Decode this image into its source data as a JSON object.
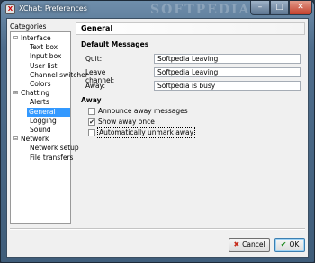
{
  "window": {
    "title": "XChat: Preferences",
    "watermark": "SOFTPEDIA",
    "minimize_glyph": "–",
    "maximize_glyph": "□",
    "close_glyph": "✕"
  },
  "sidebar": {
    "label": "Categories",
    "items": [
      {
        "label": "Interface",
        "level": 0,
        "expander": "⊟"
      },
      {
        "label": "Text box",
        "level": 1
      },
      {
        "label": "Input box",
        "level": 1
      },
      {
        "label": "User list",
        "level": 1
      },
      {
        "label": "Channel switcher",
        "level": 1
      },
      {
        "label": "Colors",
        "level": 1
      },
      {
        "label": "Chatting",
        "level": 0,
        "expander": "⊟"
      },
      {
        "label": "Alerts",
        "level": 1
      },
      {
        "label": "General",
        "level": 1,
        "selected": true
      },
      {
        "label": "Logging",
        "level": 1
      },
      {
        "label": "Sound",
        "level": 1
      },
      {
        "label": "Network",
        "level": 0,
        "expander": "⊟"
      },
      {
        "label": "Network setup",
        "level": 1
      },
      {
        "label": "File transfers",
        "level": 1
      }
    ]
  },
  "main": {
    "title": "General",
    "default_messages": {
      "heading": "Default Messages",
      "fields": [
        {
          "label": "Quit:",
          "value": "Softpedia Leaving"
        },
        {
          "label": "Leave channel:",
          "value": "Softpedia Leaving"
        },
        {
          "label": "Away:",
          "value": "Softpedia is busy"
        }
      ]
    },
    "away": {
      "heading": "Away",
      "options": [
        {
          "label": "Announce away messages",
          "checked": false
        },
        {
          "label": "Show away once",
          "checked": true
        },
        {
          "label": "Automatically unmark away",
          "checked": false,
          "focused": true
        }
      ]
    }
  },
  "buttons": {
    "cancel": {
      "label": "Cancel",
      "icon": "cancel-icon",
      "glyph": "✖"
    },
    "ok": {
      "label": "OK",
      "icon": "ok-icon",
      "glyph": "✔"
    }
  },
  "colors": {
    "selection": "#3399ff",
    "dialog_bg": "#f0f0f0"
  }
}
